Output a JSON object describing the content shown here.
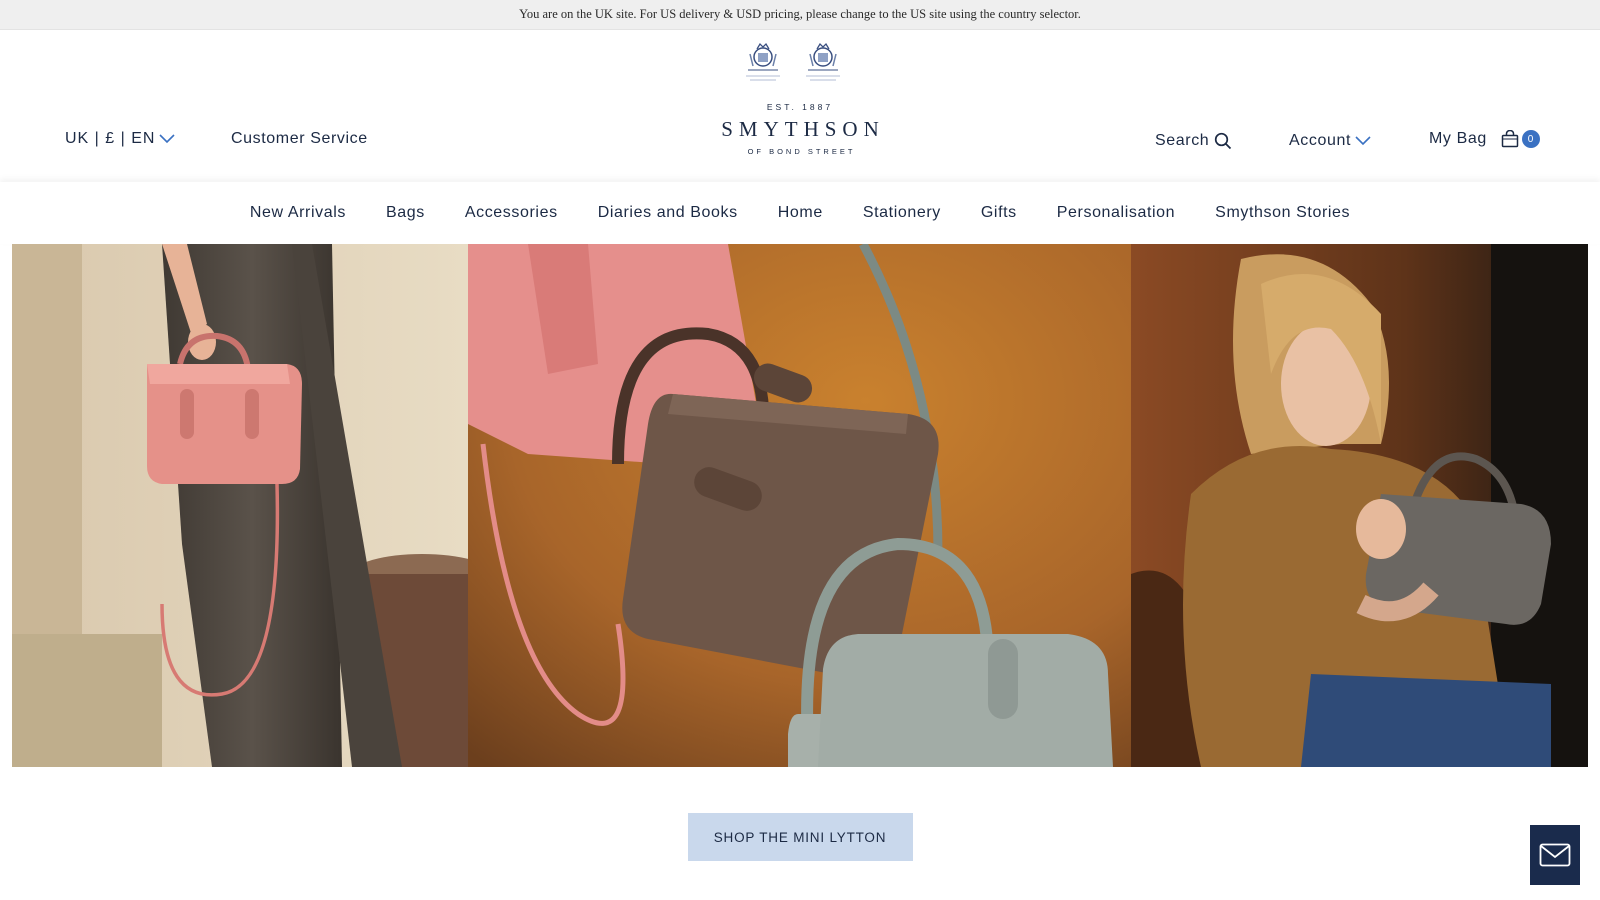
{
  "notice": {
    "text": "You are on the UK site. For US delivery & USD pricing, please change to the US site using the country selector."
  },
  "header": {
    "locale_label": "UK | £ | EN",
    "customer_service": "Customer Service",
    "logo": {
      "est": "EST. 1887",
      "name": "SMYTHSON",
      "sub": "OF BOND STREET"
    },
    "search_label": "Search",
    "account_label": "Account",
    "bag_label": "My Bag",
    "bag_count": "0"
  },
  "nav": {
    "items": [
      {
        "label": "New Arrivals"
      },
      {
        "label": "Bags"
      },
      {
        "label": "Accessories"
      },
      {
        "label": "Diaries and Books"
      },
      {
        "label": "Home"
      },
      {
        "label": "Stationery"
      },
      {
        "label": "Gifts"
      },
      {
        "label": "Personalisation"
      },
      {
        "label": "Smythson Stories"
      }
    ]
  },
  "hero": {
    "cta_label": "SHOP THE MINI LYTTON"
  },
  "colors": {
    "navy": "#1c2a44",
    "cta_bg": "#c9d8ec",
    "badge": "#3a71c2",
    "mail_bg": "#1a2b4c"
  },
  "icons": {
    "locale": "chevron-down-icon",
    "search": "search-icon",
    "account": "chevron-down-icon",
    "bag": "shopping-bag-icon",
    "mail": "envelope-icon"
  }
}
